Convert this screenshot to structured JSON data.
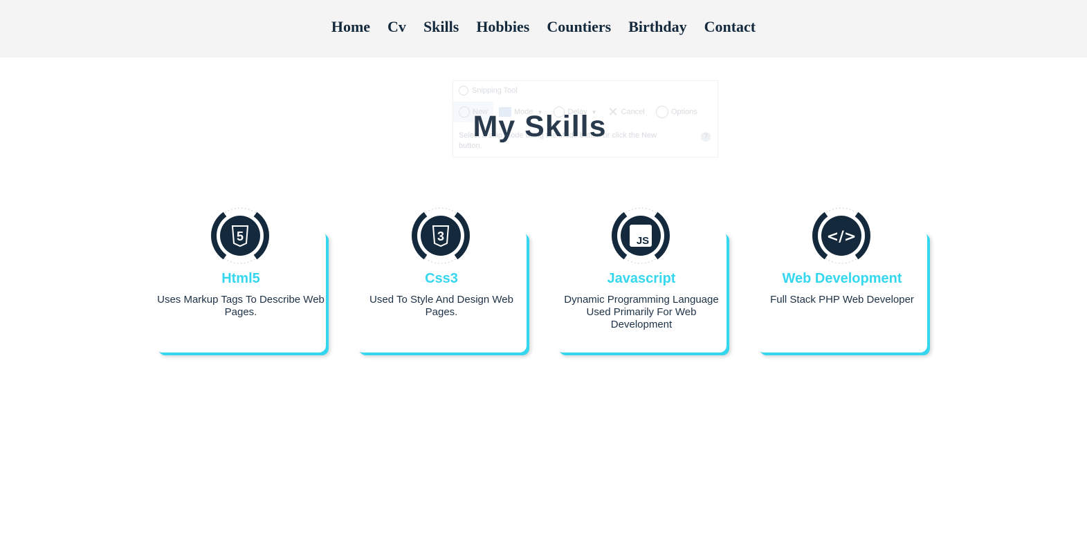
{
  "nav": {
    "items": [
      {
        "label": "Home"
      },
      {
        "label": "Cv"
      },
      {
        "label": "Skills"
      },
      {
        "label": "Hobbies"
      },
      {
        "label": "Countiers"
      },
      {
        "label": "Birthday"
      },
      {
        "label": "Contact"
      }
    ]
  },
  "snipping_tool": {
    "title": "Snipping Tool",
    "new_label": "New",
    "mode_label": "Mode",
    "delay_label": "Delay",
    "cancel_label": "Cancel",
    "options_label": "Options",
    "status_text": "Select a snip mode using the Mode button or click the New button.",
    "help_label": "?"
  },
  "page": {
    "title": "My Skills"
  },
  "skills": [
    {
      "name": "Html5",
      "description": "Uses Markup Tags To Describe Web Pages.",
      "icon": "html5-icon",
      "icon_glyph": "5"
    },
    {
      "name": "Css3",
      "description": "Used To Style And Design Web Pages.",
      "icon": "css3-icon",
      "icon_glyph": "3"
    },
    {
      "name": "Javascript",
      "description": "Dynamic Programming Language Used Primarily For Web Development",
      "icon": "js-icon",
      "icon_glyph": "JS"
    },
    {
      "name": "Web Development",
      "description": "Full Stack PHP Web Developer",
      "icon": "code-icon",
      "icon_glyph": "</>"
    }
  ],
  "colors": {
    "accent": "#35d7ee",
    "dark": "#14293c",
    "nav_bg": "#f4f4f4"
  }
}
